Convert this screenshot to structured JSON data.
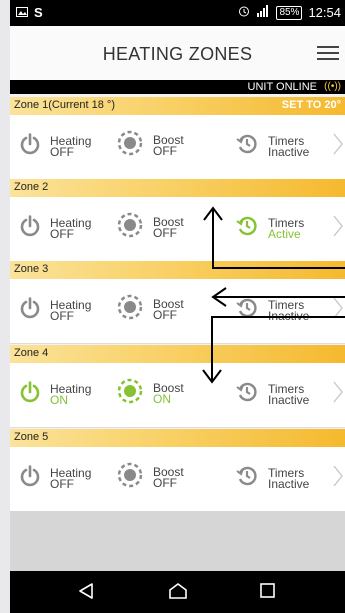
{
  "status_bar": {
    "left_icons": [
      "image-icon",
      "s-icon"
    ],
    "battery": "85%",
    "time": "12:54"
  },
  "header": {
    "title": "HEATING ZONES"
  },
  "unit_status": {
    "text": "UNIT ONLINE",
    "signal_glyph": "((•))"
  },
  "zones": [
    {
      "name": "Zone 1(Current 18 °)",
      "set": "SET TO 20°",
      "heating": {
        "label": "Heating",
        "state": "OFF",
        "on": false
      },
      "boost": {
        "label": "Boost",
        "state": "OFF",
        "on": false
      },
      "timers": {
        "label": "Timers",
        "state": "Inactive",
        "on": false
      }
    },
    {
      "name": "Zone 2",
      "set": "",
      "heating": {
        "label": "Heating",
        "state": "OFF",
        "on": false
      },
      "boost": {
        "label": "Boost",
        "state": "OFF",
        "on": false
      },
      "timers": {
        "label": "Timers",
        "state": "Active",
        "on": true
      }
    },
    {
      "name": "Zone 3",
      "set": "",
      "heating": {
        "label": "Heating",
        "state": "OFF",
        "on": false
      },
      "boost": {
        "label": "Boost",
        "state": "OFF",
        "on": false
      },
      "timers": {
        "label": "Timers",
        "state": "Inactive",
        "on": false
      }
    },
    {
      "name": "Zone 4",
      "set": "",
      "heating": {
        "label": "Heating",
        "state": "ON",
        "on": true
      },
      "boost": {
        "label": "Boost",
        "state": "ON",
        "on": true
      },
      "timers": {
        "label": "Timers",
        "state": "Inactive",
        "on": false
      }
    },
    {
      "name": "Zone 5",
      "set": "",
      "heating": {
        "label": "Heating",
        "state": "OFF",
        "on": false
      },
      "boost": {
        "label": "Boost",
        "state": "OFF",
        "on": false
      },
      "timers": {
        "label": "Timers",
        "state": "Inactive",
        "on": false
      }
    }
  ],
  "colors": {
    "on": "#86c232",
    "off": "#8a8a8a",
    "header_gradient_start": "#fbe39a",
    "header_gradient_end": "#f5b92f"
  },
  "nav": {
    "buttons": [
      "back-icon",
      "home-icon",
      "recents-icon"
    ]
  }
}
